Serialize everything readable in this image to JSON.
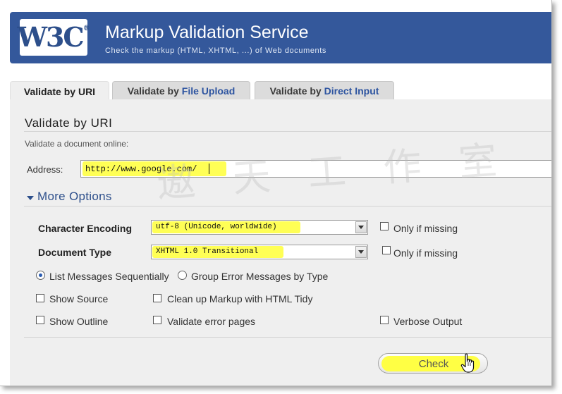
{
  "header": {
    "logo_text": "W3C",
    "logo_reg": "®",
    "title": "Markup Validation Service",
    "subtitle": "Check the markup (HTML, XHTML, ...) of Web documents",
    "color": "#34589b"
  },
  "tabs": [
    {
      "prefix": "Validate by ",
      "highlight": "URI",
      "active": true
    },
    {
      "prefix": "Validate by ",
      "highlight": "File Upload",
      "active": false
    },
    {
      "prefix": "Validate by ",
      "highlight": "Direct Input",
      "active": false
    }
  ],
  "main": {
    "section_title": "Validate by URI",
    "description": "Validate a document online:",
    "address_label": "Address:",
    "address_value": "http://www.google.com/",
    "more_options_label": "More Options",
    "encoding": {
      "label": "Character Encoding",
      "value": "utf-8 (Unicode, worldwide)",
      "only_if_missing": "Only if missing"
    },
    "doctype": {
      "label": "Document Type",
      "value": "XHTML 1.0 Transitional",
      "only_if_missing": "Only if missing"
    },
    "radio_list": "List Messages Sequentially",
    "radio_group": "Group Error Messages by Type",
    "show_source": "Show Source",
    "cleanup": "Clean up Markup with HTML Tidy",
    "show_outline": "Show Outline",
    "validate_error_pages": "Validate error pages",
    "verbose_output": "Verbose Output",
    "check_label": "Check"
  },
  "watermark": "遨 天 工 作 室",
  "colors": {
    "highlight": "#ffff55",
    "link_blue": "#2d4f8b"
  }
}
